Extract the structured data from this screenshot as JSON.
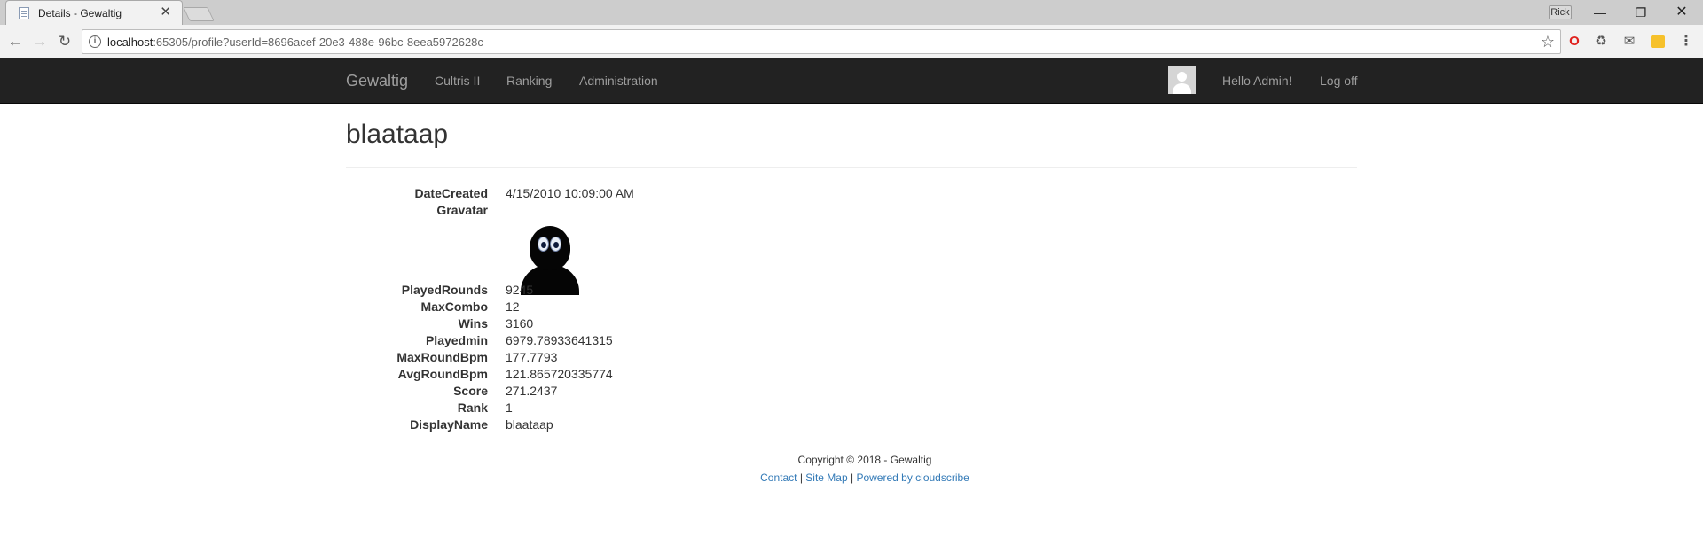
{
  "browser": {
    "tab_title": "Details - Gewaltig",
    "tab_close": "✕",
    "user_badge": "Rick",
    "url_host": "localhost",
    "url_rest": ":65305/profile?userId=8696acef-20e3-488e-96bc-8eea5972628c",
    "window_controls": {
      "minimize": "—",
      "maximize": "❐",
      "close": "✕"
    }
  },
  "navbar": {
    "brand": "Gewaltig",
    "links": [
      "Cultris II",
      "Ranking",
      "Administration"
    ],
    "greeting": "Hello Admin!",
    "logoff": "Log off"
  },
  "profile": {
    "title": "blaataap",
    "fields": {
      "date_created": {
        "label": "DateCreated",
        "value": "4/15/2010 10:09:00 AM"
      },
      "gravatar": {
        "label": "Gravatar"
      },
      "played_rounds": {
        "label": "PlayedRounds",
        "value": "9245"
      },
      "max_combo": {
        "label": "MaxCombo",
        "value": "12"
      },
      "wins": {
        "label": "Wins",
        "value": "3160"
      },
      "playedmin": {
        "label": "Playedmin",
        "value": "6979.78933641315"
      },
      "max_round_bpm": {
        "label": "MaxRoundBpm",
        "value": "177.7793"
      },
      "avg_round_bpm": {
        "label": "AvgRoundBpm",
        "value": "121.865720335774"
      },
      "score": {
        "label": "Score",
        "value": "271.2437"
      },
      "rank": {
        "label": "Rank",
        "value": "1"
      },
      "display_name": {
        "label": "DisplayName",
        "value": "blaataap"
      }
    }
  },
  "footer": {
    "copyright": "Copyright © 2018 - Gewaltig",
    "links": [
      "Contact",
      "Site Map",
      "Powered by cloudscribe"
    ],
    "separator": " | "
  },
  "icons": {
    "back": "back-arrow-icon",
    "forward": "forward-arrow-icon",
    "reload": "reload-icon",
    "info": "info-icon",
    "star": "star-icon",
    "menu": "menu-icon"
  }
}
